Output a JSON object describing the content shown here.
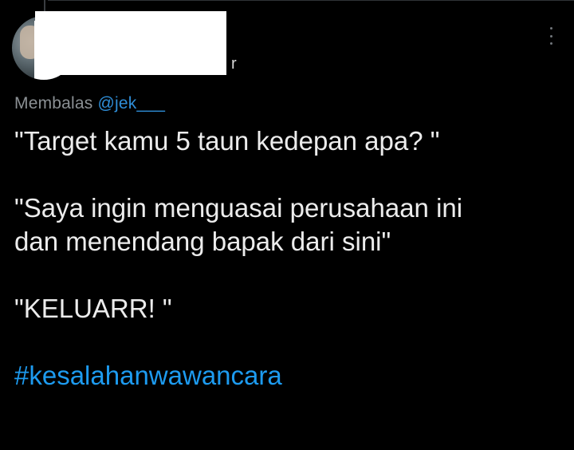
{
  "reply": {
    "prefix": "Membalas",
    "handle": "@jek___"
  },
  "author": {
    "name_tail": "r"
  },
  "tweet": {
    "lines": [
      "\"Target kamu 5 taun kedepan apa? \"",
      "\"Saya ingin menguasai perusahaan ini",
      "dan menendang bapak dari sini\"",
      "\"KELUARR! \""
    ],
    "hashtag": "#kesalahanwawancara"
  },
  "icons": {
    "menu": "more-vertical-icon"
  },
  "colors": {
    "background": "#000000",
    "text": "#ececec",
    "muted": "#8b9094",
    "link": "#1d9bf0"
  }
}
